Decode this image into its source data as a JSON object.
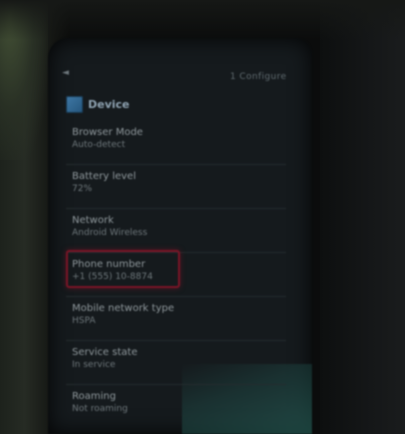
{
  "topbar": {
    "hint_icon": "back-arrow-icon",
    "action_label": "1 Configure"
  },
  "header": {
    "title": "Device",
    "icon": "settings-app-icon"
  },
  "settings": [
    {
      "title": "Browser Mode",
      "subtitle": "Auto-detect"
    },
    {
      "title": "Battery level",
      "subtitle": "72%"
    },
    {
      "title": "Network",
      "subtitle": "Android Wireless"
    },
    {
      "title": "Phone number",
      "subtitle": "+1 (555) 10-8874"
    },
    {
      "title": "Mobile network type",
      "subtitle": "HSPA"
    },
    {
      "title": "Service state",
      "subtitle": "In service"
    },
    {
      "title": "Roaming",
      "subtitle": "Not roaming"
    }
  ],
  "highlight": {
    "color": "#7a1426",
    "target_index": 3
  }
}
